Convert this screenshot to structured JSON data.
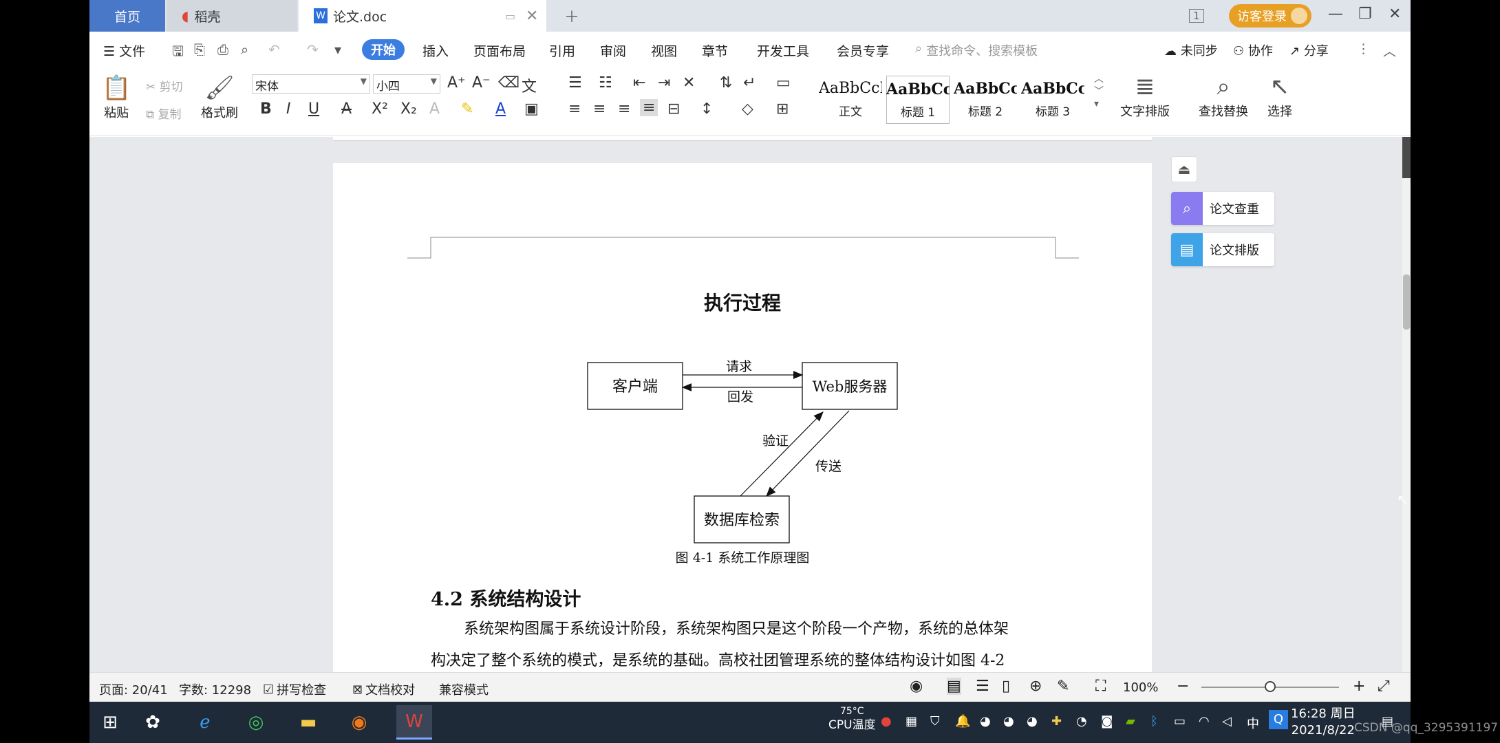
{
  "tabs": {
    "home": "首页",
    "daoke": "稻壳",
    "doc": "论文.doc",
    "login": "访客登录",
    "badge": "1"
  },
  "menu": {
    "file": "文件",
    "start": "开始",
    "insert": "插入",
    "layout": "页面布局",
    "reference": "引用",
    "review": "审阅",
    "view": "视图",
    "chapter": "章节",
    "devtools": "开发工具",
    "member": "会员专享",
    "search_placeholder": "查找命令、搜索模板",
    "unsync": "未同步",
    "collab": "协作",
    "share": "分享"
  },
  "ribbon": {
    "paste": "粘贴",
    "cut": "剪切",
    "copy": "复制",
    "format_painter": "格式刷",
    "font_name": "宋体",
    "font_size": "小四",
    "styles": [
      {
        "preview": "AaBbCcI",
        "name": "正文"
      },
      {
        "preview": "AaBbCc",
        "name": "标题 1"
      },
      {
        "preview": "AaBbCcI",
        "name": "标题 2"
      },
      {
        "preview": "AaBbCc",
        "name": "标题 3"
      }
    ],
    "text_layout": "文字排版",
    "find_replace": "查找替换",
    "select": "选择"
  },
  "sidepanel": {
    "check": "论文查重",
    "format": "论文排版"
  },
  "document": {
    "diagram_title": "执行过程",
    "nodes": {
      "client": "客户端",
      "server": "Web服务器",
      "db": "数据库检索"
    },
    "edges": {
      "request": "请求",
      "reply": "回发",
      "verify": "验证",
      "transfer": "传送"
    },
    "caption": "图 4-1  系统工作原理图",
    "section_heading": "4.2  系统结构设计",
    "para_line1": "系统架构图属于系统设计阶段，系统架构图只是这个阶段一个产物，系统的总体架",
    "para_line2": "构决定了整个系统的模式，是系统的基础。高校社团管理系统的整体结构设计如图 4-2"
  },
  "statusbar": {
    "page": "页面: 20/41",
    "words": "字数: 12298",
    "spell": "拼写检查",
    "proof": "文档校对",
    "compat": "兼容模式",
    "zoom": "100%"
  },
  "taskbar": {
    "temp": "75°C",
    "cpu": "CPU温度",
    "ime": "中",
    "time": "16:28 周日",
    "date": "2021/8/22",
    "watermark": "CSDN @qq_3295391197"
  },
  "colors": {
    "accent": "#3b7de0",
    "login": "#e8a024",
    "home_tab": "#4a78c8"
  }
}
